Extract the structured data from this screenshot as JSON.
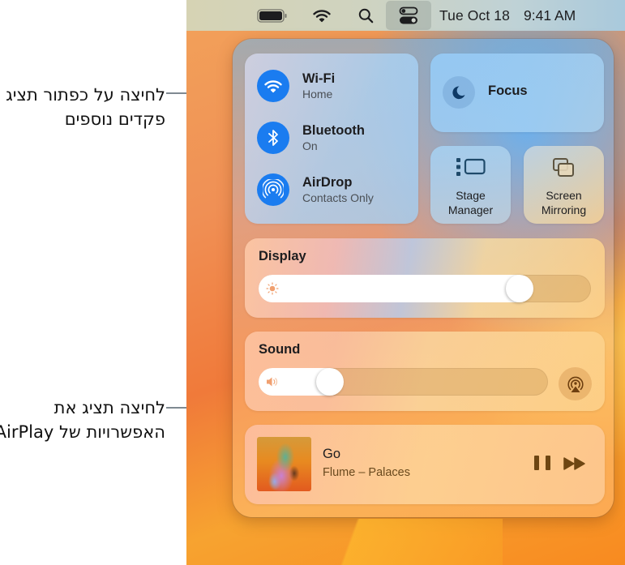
{
  "callouts": {
    "controls_button": "לחיצה על כפתור תציג פקדים נוספים",
    "airplay": "לחיצה תציג את האפשרויות של AirPlay."
  },
  "menubar": {
    "icons": [
      "battery-icon",
      "wifi-icon",
      "search-icon",
      "control-center-icon"
    ],
    "date": "Tue Oct 18",
    "time": "9:41 AM"
  },
  "control_center": {
    "network": [
      {
        "icon": "wifi-icon",
        "title": "Wi-Fi",
        "subtitle": "Home"
      },
      {
        "icon": "bluetooth-icon",
        "title": "Bluetooth",
        "subtitle": "On"
      },
      {
        "icon": "airdrop-icon",
        "title": "AirDrop",
        "subtitle": "Contacts Only"
      }
    ],
    "focus": {
      "icon": "moon-icon",
      "label": "Focus"
    },
    "stage_manager": {
      "icon": "stage-manager-icon",
      "label_line1": "Stage",
      "label_line2": "Manager"
    },
    "screen_mirroring": {
      "icon": "screen-mirroring-icon",
      "label_line1": "Screen",
      "label_line2": "Mirroring"
    },
    "display": {
      "label": "Display",
      "brightness_percent": 81
    },
    "sound": {
      "label": "Sound",
      "volume_percent": 22,
      "airplay_icon": "airplay-audio-icon"
    },
    "now_playing": {
      "title": "Go",
      "subtitle": "Flume – Palaces",
      "album_art": "album-art",
      "controls": [
        "pause-icon",
        "forward-icon"
      ]
    }
  },
  "colors": {
    "accent_blue": "#1a7cf0",
    "media_control_brown": "#6e4612",
    "leader_line": "#7f8a91"
  }
}
